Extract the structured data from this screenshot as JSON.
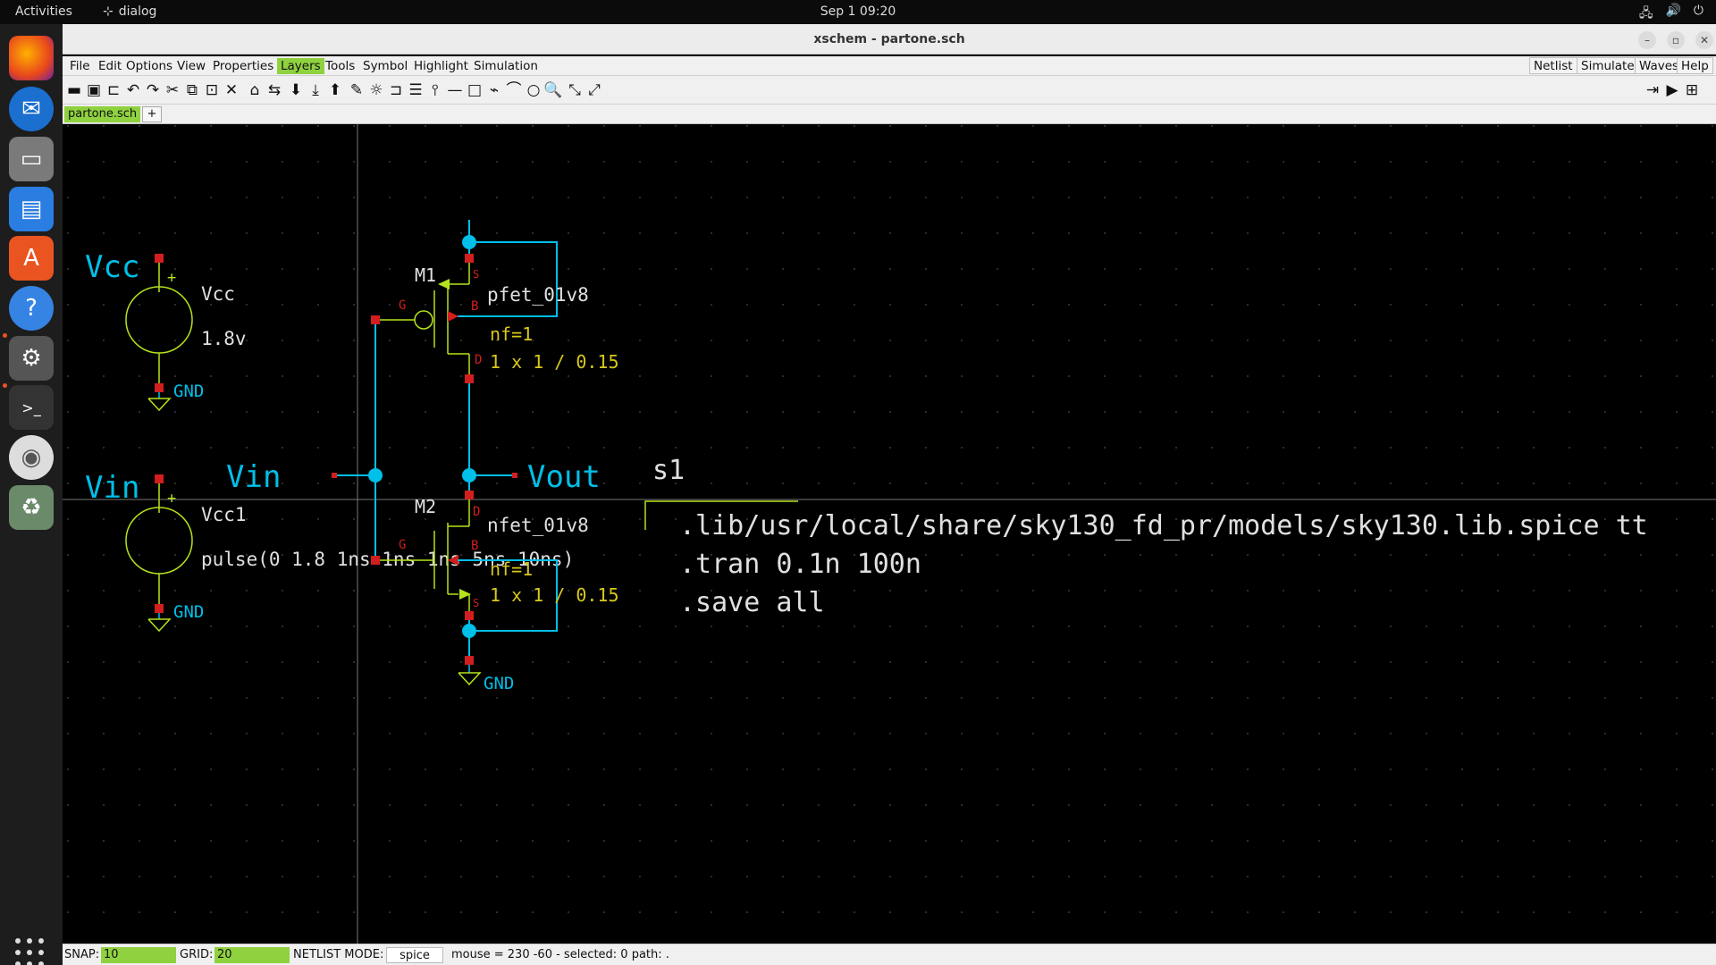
{
  "topbar": {
    "activities": "Activities",
    "app_name": "dialog",
    "clock": "Sep 1  09:20"
  },
  "window": {
    "title": "xschem - partone.sch"
  },
  "menu": {
    "left": [
      "File",
      "Edit",
      "Options",
      "View",
      "Properties",
      "Layers",
      "Tools",
      "Symbol",
      "Highlight",
      "Simulation"
    ],
    "highlighted": "Layers",
    "right": [
      "Netlist",
      "Simulate",
      "Waves",
      "Help"
    ]
  },
  "tabs": {
    "active": "partone.sch",
    "add": "+"
  },
  "schematic": {
    "sources": [
      {
        "net": "Vcc",
        "name": "Vcc",
        "value": "1.8v",
        "plus": "+",
        "gnd": "GND"
      },
      {
        "net": "Vin",
        "name": "Vcc1",
        "value": "pulse(0 1.8 1ns 1ns 1ns 5ns 10ns)",
        "plus": "+",
        "gnd": "GND"
      }
    ],
    "input_label": "Vin",
    "output_label": "Vout",
    "m1": {
      "name": "M1",
      "model": "pfet_01v8",
      "nf": "nf=1",
      "size": "1 x 1 / 0.15",
      "pins": {
        "g": "G",
        "s": "S",
        "b": "B",
        "d": "D"
      }
    },
    "m2": {
      "name": "M2",
      "model": "nfet_01v8",
      "nf": "nf=1",
      "size": "1 x 1 / 0.15",
      "pins": {
        "g": "G",
        "s": "S",
        "b": "B",
        "d": "D"
      }
    },
    "m2_gnd": "GND",
    "code_block": {
      "name": "s1",
      "lines": [
        ".lib/usr/local/share/sky130_fd_pr/models/sky130.lib.spice tt",
        ".tran 0.1n 100n",
        ".save all"
      ]
    },
    "colors": {
      "wire": "#00bfe8",
      "symbol": "#b5e31c",
      "pin": "#d21e1e",
      "attr": "#d8c81b",
      "text": "#e0e0e0",
      "grid": "#3a3a3a"
    }
  },
  "status": {
    "snap_label": "SNAP:",
    "snap_value": "10",
    "grid_label": "GRID:",
    "grid_value": "20",
    "netlist_label": "NETLIST MODE:",
    "netlist_value": "spice",
    "info": "mouse = 230 -60 - selected: 0 path: ."
  }
}
